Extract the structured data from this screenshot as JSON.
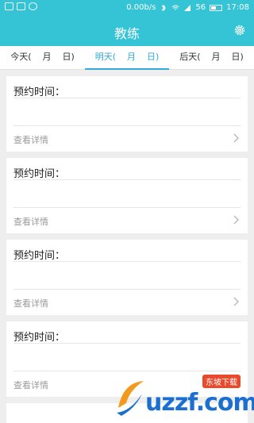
{
  "status_bar": {
    "network_speed": "0.00b/s",
    "signal": "56",
    "time": "17:08"
  },
  "app": {
    "title": "教练",
    "settings_icon": "gear-icon"
  },
  "tabs": [
    {
      "prefix": "今天(",
      "month_suffix": "月",
      "day_suffix": "日)",
      "active": false
    },
    {
      "prefix": "明天(",
      "month_suffix": "月",
      "day_suffix": "日)",
      "active": true
    },
    {
      "prefix": "后天(",
      "month_suffix": "月",
      "day_suffix": "日)",
      "active": false
    }
  ],
  "cards": [
    {
      "title": "预约时间：",
      "details_label": "查看详情"
    },
    {
      "title": "预约时间：",
      "details_label": "查看详情"
    },
    {
      "title": "预约时间：",
      "details_label": "查看详情"
    },
    {
      "title": "预约时间：",
      "details_label": "查看详情"
    }
  ],
  "watermark": {
    "text": "uzzf.com",
    "badge": "东坡下载"
  },
  "colors": {
    "accent": "#35c4d5",
    "tab_active": "#35a9d8",
    "background": "#eeeeee"
  }
}
